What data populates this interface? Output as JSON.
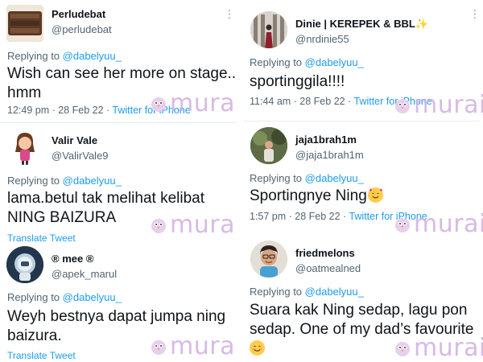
{
  "colors": {
    "link": "#1d9bf0",
    "muted": "#536471",
    "text": "#0f1419",
    "watermark": "#d4b3e3"
  },
  "watermark": {
    "text": "murai",
    "icon": "bird-icon"
  },
  "left": [
    {
      "name": "Perludebat",
      "handle": "@perludebat",
      "reply_prefix": "Replying to",
      "reply_to": "@dabelyuu_",
      "body": [
        "Wish can see her more on stage..",
        "hmm"
      ],
      "time": "12:49 pm · 28 Feb 22 ·",
      "source": "Twitter for iPhone"
    },
    {
      "name": "Valir Vale",
      "handle": "@ValirVale9",
      "reply_prefix": "Replying to",
      "reply_to": "@dabelyuu_",
      "body": [
        "lama.betul tak melihat kelibat",
        "NING BAIZURA"
      ],
      "translate": "Translate Tweet"
    },
    {
      "name": "® mee ®",
      "handle": "@apek_marul",
      "reply_prefix": "Replying to",
      "reply_to": "@dabelyuu_",
      "body": [
        "Weyh bestnya dapat jumpa ning",
        "baizura."
      ],
      "translate": "Translate Tweet"
    }
  ],
  "right": [
    {
      "name": "Dinie | KEREPEK & BBL",
      "name_emoji": "✨",
      "handle": "@nrdinie55",
      "reply_prefix": "Replying to",
      "reply_to": "@dabelyuu_",
      "body": [
        "sportinggila!!!!"
      ],
      "time": "11:44 am · 28 Feb 22 ·",
      "source": "Twitter for iPhone"
    },
    {
      "name": "jaja1brah1m",
      "handle": "@jaja1brah1m",
      "reply_prefix": "Replying to",
      "reply_to": "@dabelyuu_",
      "body": [
        "Sportingnye Ning"
      ],
      "body_emoji": "smiling-face-with-hearts-emoji",
      "time": "1:57 pm · 28 Feb 22 ·",
      "source": "Twitter for iPhone"
    },
    {
      "name": "friedmelons",
      "handle": "@oatmealned",
      "reply_prefix": "Replying to",
      "reply_to": "@dabelyuu_",
      "body": [
        "Suara kak Ning sedap, lagu pon",
        "sedap. One of my dad’s favourite"
      ],
      "body_emoji": "smiling-face-emoji"
    }
  ]
}
